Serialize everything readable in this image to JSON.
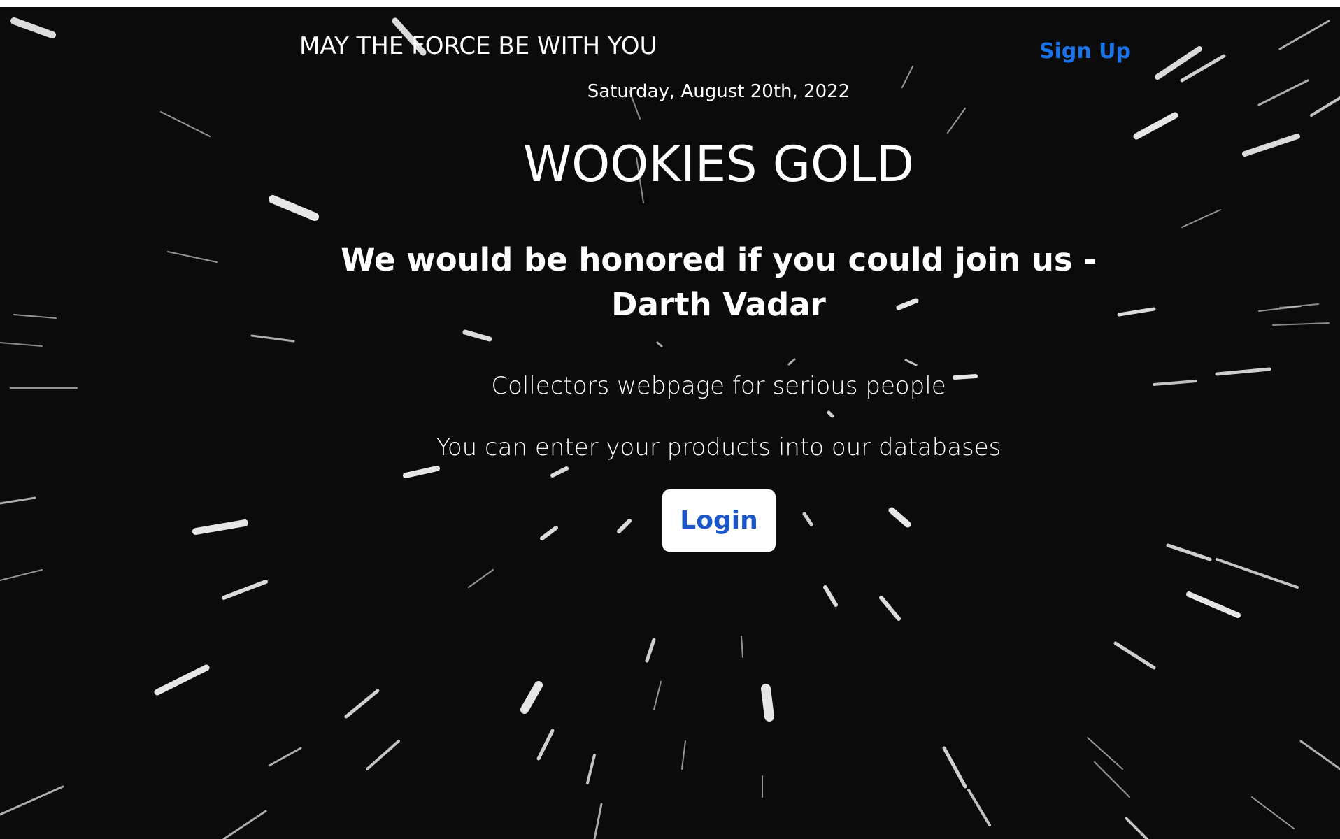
{
  "nav": {
    "brand": "MAY THE FORCE BE WITH YOU",
    "signup_label": "Sign Up"
  },
  "hero": {
    "date": "Saturday, August 20th, 2022",
    "title": "WOOKIES GOLD",
    "invite": "We would be honored if you could join us - Darth Vadar",
    "tagline": "Collectors webpage for serious people",
    "subline": "You can enter your products into our databases",
    "login_label": "Login"
  },
  "colors": {
    "background": "#0b0b0b",
    "text": "#ffffff",
    "link": "#1a73e8",
    "button_text": "#1a56c8",
    "button_bg": "#ffffff"
  }
}
